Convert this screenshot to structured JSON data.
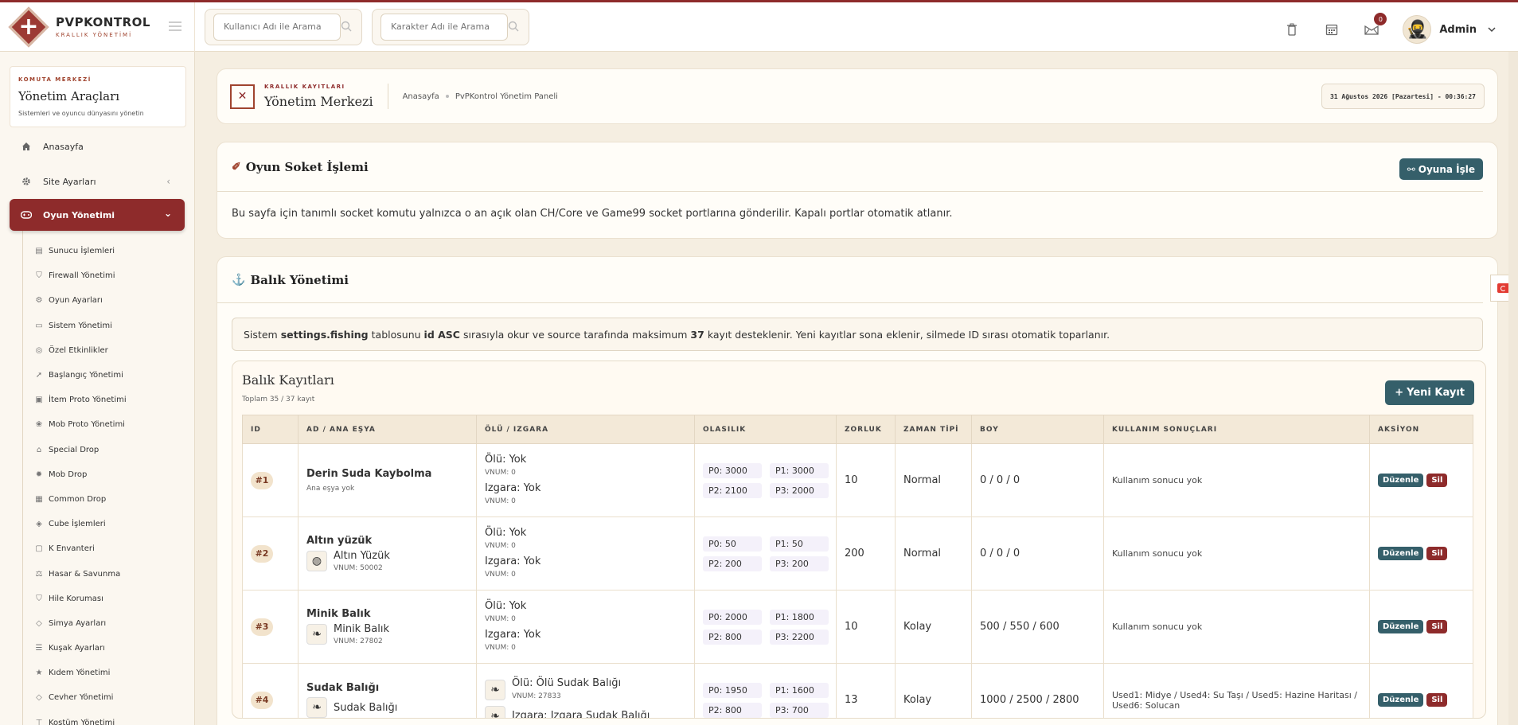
{
  "brand": {
    "title": "PVPKONTROL",
    "subtitle": "KRALLIK YÖNETİMİ"
  },
  "search": {
    "user_placeholder": "Kullanıcı Adı ile Arama",
    "char_placeholder": "Karakter Adı ile Arama"
  },
  "header": {
    "notif_count": "0",
    "user_name": "Admin"
  },
  "sidebar": {
    "kicker": "KOMUTA MERKEZİ",
    "title": "Yönetim Araçları",
    "subtitle": "Sistemleri ve oyuncu dünyasını yönetin",
    "items": [
      {
        "label": "Anasayfa",
        "icon": "home-icon"
      },
      {
        "label": "Site Ayarları",
        "icon": "gear-icon"
      },
      {
        "label": "Oyun Yönetimi",
        "icon": "gamepad-icon"
      }
    ],
    "sub_items": [
      {
        "label": "Sunucu İşlemleri",
        "icon": "server-icon"
      },
      {
        "label": "Firewall Yönetimi",
        "icon": "shield-icon"
      },
      {
        "label": "Oyun Ayarları",
        "icon": "cogs-icon"
      },
      {
        "label": "Sistem Yönetimi",
        "icon": "desktop-icon"
      },
      {
        "label": "Özel Etkinlikler",
        "icon": "gamepad-icon"
      },
      {
        "label": "Başlangıç Yönetimi",
        "icon": "rocket-icon"
      },
      {
        "label": "İtem Proto Yönetimi",
        "icon": "box-icon"
      },
      {
        "label": "Mob Proto Yönetimi",
        "icon": "paw-icon"
      },
      {
        "label": "Special Drop",
        "icon": "gift-icon"
      },
      {
        "label": "Mob Drop",
        "icon": "bug-icon"
      },
      {
        "label": "Common Drop",
        "icon": "table-icon"
      },
      {
        "label": "Cube İşlemleri",
        "icon": "cube-icon"
      },
      {
        "label": "K Envanteri",
        "icon": "inventory-icon"
      },
      {
        "label": "Hasar & Savunma",
        "icon": "scale-icon"
      },
      {
        "label": "Hile Koruması",
        "icon": "shield-icon"
      },
      {
        "label": "Simya Ayarları",
        "icon": "gem-icon"
      },
      {
        "label": "Kuşak Ayarları",
        "icon": "sliders-icon"
      },
      {
        "label": "Kıdem Yönetimi",
        "icon": "star-icon"
      },
      {
        "label": "Cevher Yönetimi",
        "icon": "gem-icon"
      },
      {
        "label": "Kostüm Yönetimi",
        "icon": "shirt-icon"
      }
    ]
  },
  "crumb": {
    "kicker": "KRALLIK KAYITLARI",
    "title": "Yönetim Merkezi",
    "home": "Anasayfa",
    "page": "PvPKontrol Yönetim Paneli",
    "datetime": "31 Ağustos 2026 [Pazartesi] - 00:36:27"
  },
  "socket": {
    "title": "Oyun Soket İşlemi",
    "button": "Oyuna İşle",
    "desc": "Bu sayfa için tanımlı socket komutu yalnızca o an açık olan CH/Core ve Game99 socket portlarına gönderilir. Kapalı portlar otomatik atlanır."
  },
  "fish": {
    "title": "Balık Yönetimi",
    "info_pre": "Sistem",
    "info_table": "settings.fishing",
    "info_mid": "tablosunu",
    "info_order": "id ASC",
    "info_mid2": "sırasıyla okur ve source tarafında maksimum",
    "info_max": "37",
    "info_post": "kayıt desteklenir. Yeni kayıtlar sona eklenir, silmede ID sırası otomatik toparlanır.",
    "list_title": "Balık Kayıtları",
    "list_sub": "Toplam 35 / 37 kayıt",
    "new_button": "Yeni Kayıt",
    "columns": [
      "ID",
      "AD / ANA EŞYA",
      "ÖLÜ / IZGARA",
      "OLASILIK",
      "ZORLUK",
      "ZAMAN TİPİ",
      "BOY",
      "KULLANIM SONUÇLARI",
      "AKSİYON"
    ],
    "rows": [
      {
        "id": "#1",
        "name": "Derin Suda Kaybolma",
        "item_none": "Ana eşya yok",
        "dead": "Ölü: Yok",
        "dead_vnum": "VNUM: 0",
        "grill": "Izgara: Yok",
        "grill_vnum": "VNUM: 0",
        "p0": "P0: 3000",
        "p1": "P1: 3000",
        "p2": "P2: 2100",
        "p3": "P3: 2000",
        "diff": "10",
        "time": "Normal",
        "size": "0 / 0 / 0",
        "usage": "Kullanım sonucu yok",
        "edit": "Düzenle",
        "del": "Sil"
      },
      {
        "id": "#2",
        "name": "Altın yüzük",
        "item_name": "Altın Yüzük",
        "item_vnum": "VNUM: 50002",
        "dead": "Ölü: Yok",
        "dead_vnum": "VNUM: 0",
        "grill": "Izgara: Yok",
        "grill_vnum": "VNUM: 0",
        "p0": "P0: 50",
        "p1": "P1: 50",
        "p2": "P2: 200",
        "p3": "P3: 200",
        "diff": "200",
        "time": "Normal",
        "size": "0 / 0 / 0",
        "usage": "Kullanım sonucu yok",
        "edit": "Düzenle",
        "del": "Sil"
      },
      {
        "id": "#3",
        "name": "Minik Balık",
        "item_name": "Minik Balık",
        "item_vnum": "VNUM: 27802",
        "dead": "Ölü: Yok",
        "dead_vnum": "VNUM: 0",
        "grill": "Izgara: Yok",
        "grill_vnum": "VNUM: 0",
        "p0": "P0: 2000",
        "p1": "P1: 1800",
        "p2": "P2: 800",
        "p3": "P3: 2200",
        "diff": "10",
        "time": "Kolay",
        "size": "500 / 550 / 600",
        "usage": "Kullanım sonucu yok",
        "edit": "Düzenle",
        "del": "Sil"
      },
      {
        "id": "#4",
        "name": "Sudak Balığı",
        "item_name": "Sudak Balığı",
        "dead": "Ölü: Ölü Sudak Balığı",
        "dead_vnum": "VNUM: 27833",
        "grill": "Izgara: Izgara Sudak Balığı",
        "p0": "P0: 1950",
        "p1": "P1: 1600",
        "p2": "P2: 800",
        "p3": "P3: 700",
        "diff": "13",
        "time": "Kolay",
        "size": "1000 / 2500 / 2800",
        "usage": "Used1: Midye / Used4: Su Taşı / Used5: Hazine Haritası / Used6: Solucan",
        "edit": "Düzenle",
        "del": "Sil"
      }
    ]
  },
  "colors": {
    "accent": "#8e2b2b",
    "teal": "#355f6a",
    "bg": "#f5eee1"
  }
}
